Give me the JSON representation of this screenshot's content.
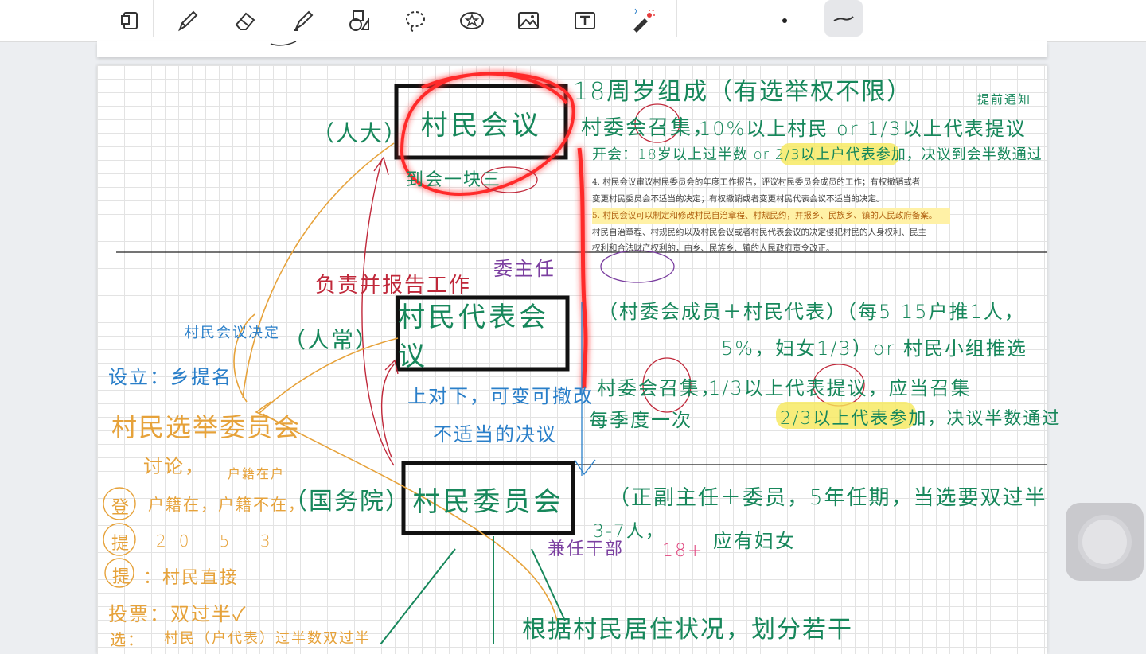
{
  "toolbar": {
    "tools": [
      "pages-icon",
      "pen-icon",
      "eraser-icon",
      "highlighter-icon",
      "shapes-icon",
      "lasso-icon",
      "sticker-icon",
      "image-icon",
      "text-icon",
      "laser-pointer-icon"
    ],
    "stroke_size_icon": "dot-icon",
    "pen_style_icon": "stroke-style-icon"
  },
  "boxes": {
    "top": "村民会议",
    "middle": "村民代表会议",
    "bottom": "村民委员会"
  },
  "notes": {
    "age_line": "18周岁组成（有选举权不限）",
    "convene_top": "村委会召集，",
    "proposal_top": "10%以上村民 or 1/3以上代表提议",
    "notify": "提前通知",
    "meeting_top": "开会：18岁以上过半数 or 2/3以上户代表参加，决议到会半数通过",
    "renda": "（人大）",
    "once_year": "到会一块三",
    "responsible": "负责并报告工作",
    "zhuren": "委主任",
    "renchang": "（人常）",
    "guowuyuan": "（国务院）",
    "members_mid": "（村委会成员＋村民代表）（每5-15户推1人，",
    "village_group": "5%，妇女1/3）or 村民小组推选",
    "convene_mid": "村委会召集，",
    "proposal_mid": "1/3以上代表提议，应当召集",
    "quorum_mid": "2/3以上代表参加，决议半数通过",
    "quarterly": "每季度一次",
    "up_down_1": "上对下，可变可撤改",
    "up_down_2": "不适当的决议",
    "cunweihui_members": "（正副主任＋委员，5年任期，当选要双过半",
    "count_range": "3-7人，",
    "women": "应有妇女",
    "zhiban": "兼任干部",
    "eighteen": "18+",
    "election_committee": "村民选举委员会",
    "set_up": "设立：乡提名",
    "meeting_decide": "村民会议决定",
    "discuss": "讨论，",
    "registration": "户籍在户",
    "reg_label": "登",
    "reg_text": "户籍在，户籍不在，",
    "cand_label": "提",
    "cand_numbers": "20  5  3",
    "nom_label": "提",
    "nom_text": "：村民直接",
    "vote": "投票：双过半✓",
    "elect_label": "选：",
    "elect_text": "村民（户代表）过半数双过半",
    "bottom_note": "根据村民居住状况，划分若干"
  },
  "printed_excerpt": {
    "line1": "4. 村民会议审议村民委员会的年度工作报告，评议村民委员会成员的工作；有权撤销或者",
    "line2": "变更村民委员会不适当的决定；有权撤销或者变更村民代表会议不适当的决定。",
    "line3": "5. 村民会议可以制定和修改村民自治章程、村规民约，并报乡、民族乡、镇的人民政府备案。",
    "line4": "村民自治章程、村规民约以及村民会议或者村民代表会议的决定侵犯村民的人身权利、民主",
    "line5": "权利和合法财产权利的，由乡、民族乡、镇的人民政府责令改正。"
  },
  "colors": {
    "green_ink": "#17875b",
    "blue_ink": "#2a7fc9",
    "red_ink": "#c0283a",
    "orange_ink": "#e6a23a",
    "purple_ink": "#7b3fa0",
    "highlight": "#f6e85a"
  }
}
